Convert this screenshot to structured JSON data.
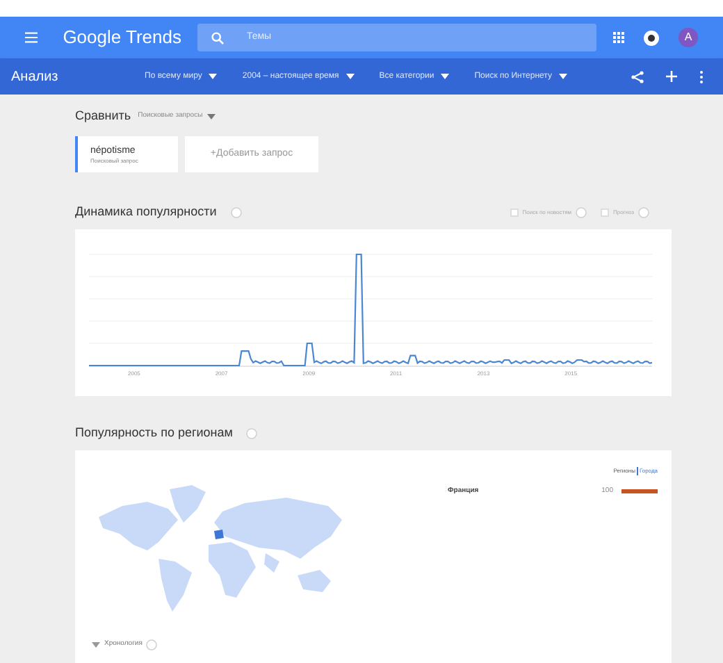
{
  "header": {
    "title": "Google Trends",
    "search_placeholder": "Темы",
    "avatar": "A"
  },
  "toolbar": {
    "title": "Анализ",
    "filters": [
      "По всему миру",
      "2004 – настоящее время",
      "Все категории",
      "Поиск по Интернету"
    ]
  },
  "compare": {
    "title": "Сравнить",
    "type_label": "Поисковые запросы",
    "terms": [
      {
        "term": "népotisme",
        "subtitle": "Поисковый запрос",
        "selected": true
      }
    ],
    "add_label": "+Добавить запрос"
  },
  "interest_over_time": {
    "title": "Динамика популярности",
    "options": [
      {
        "label": "Поиск по новостям",
        "checked": false
      },
      {
        "label": "Прогноз",
        "checked": false
      }
    ],
    "x_labels": [
      "2005",
      "2007",
      "2009",
      "2011",
      "2013",
      "2015"
    ]
  },
  "regions": {
    "title": "Популярность по регионам",
    "view_links": [
      {
        "label": "Регионы",
        "selected": true
      },
      {
        "label": "Города",
        "selected": false
      }
    ],
    "rows": [
      {
        "name": "Франция",
        "value": "100",
        "level": 1
      }
    ],
    "timeline_label": "Хронология"
  }
}
